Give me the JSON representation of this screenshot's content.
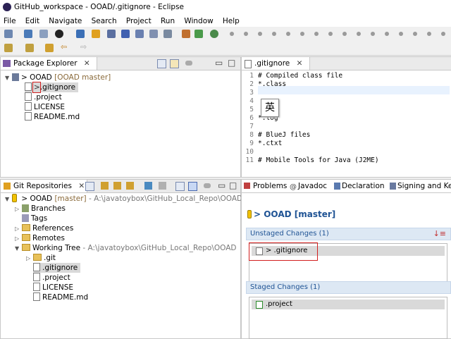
{
  "window": {
    "title": "GitHub_workspace - OOAD/.gitignore - Eclipse"
  },
  "menu": [
    "File",
    "Edit",
    "Navigate",
    "Search",
    "Project",
    "Run",
    "Window",
    "Help"
  ],
  "package_explorer": {
    "tab_label": "Package Explorer",
    "project": "> OOAD",
    "project_branch": "[OOAD master]",
    "items": [
      ".gitignore",
      ".project",
      "LICENSE",
      "README.md"
    ]
  },
  "editor": {
    "tab_label": ".gitignore",
    "lines": [
      {
        "n": "1",
        "text": "# Compiled class file"
      },
      {
        "n": "2",
        "text": "*.class"
      },
      {
        "n": "3",
        "text": ""
      },
      {
        "n": "4",
        "text": ""
      },
      {
        "n": "5",
        "text": "    file"
      },
      {
        "n": "6",
        "text": "*.log"
      },
      {
        "n": "7",
        "text": ""
      },
      {
        "n": "8",
        "text": "# BlueJ files"
      },
      {
        "n": "9",
        "text": "*.ctxt"
      },
      {
        "n": "10",
        "text": ""
      },
      {
        "n": "11",
        "text": "# Mobile Tools for Java (J2ME)"
      }
    ],
    "ime_popup": "英"
  },
  "git_repos": {
    "tab_label": "Git Repositories",
    "repo": "> OOAD",
    "repo_branch": "[master]",
    "repo_path": "- A:\\javatoybox\\GitHub_Local_Repo\\OOAD\\.git",
    "nodes": [
      "Branches",
      "Tags",
      "References",
      "Remotes"
    ],
    "working_tree": "Working Tree",
    "working_tree_path": "- A:\\javatoybox\\GitHub_Local_Repo\\OOAD",
    "tree_items": [
      ".git",
      ".gitignore",
      ".project",
      "LICENSE",
      "README.md"
    ]
  },
  "bottom_tabs": [
    "Problems",
    "Javadoc",
    "Declaration",
    "Signing and Keys"
  ],
  "staging": {
    "header": "> OOAD [master]",
    "unstaged_label": "Unstaged Changes (1)",
    "unstaged_items": [
      "> .gitignore"
    ],
    "staged_label": "Staged Changes (1)",
    "staged_items": [
      ".project"
    ]
  }
}
